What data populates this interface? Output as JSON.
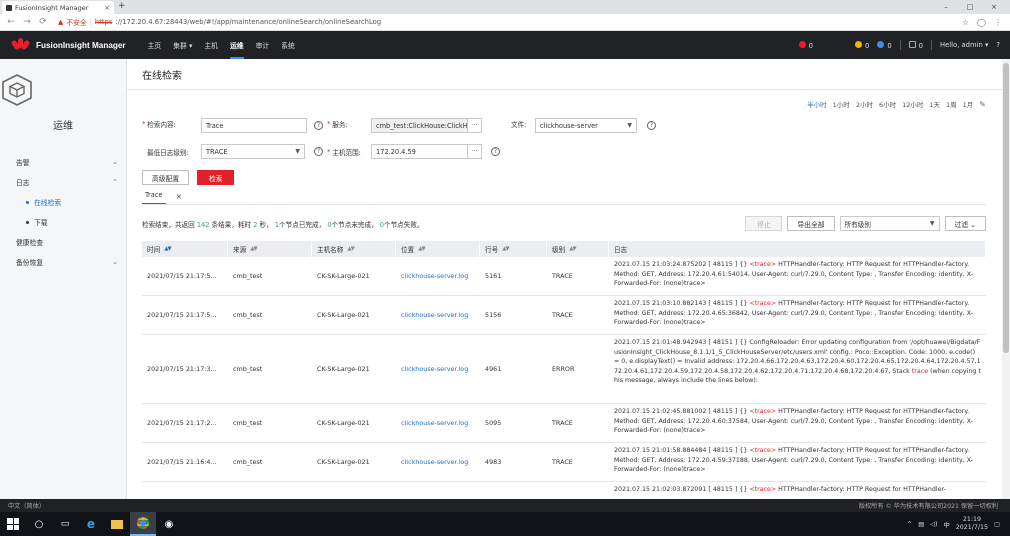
{
  "browser": {
    "tab_title": "FusionInsight Manager",
    "tab_close": "×",
    "new_tab": "+",
    "security_label": "不安全",
    "url_scheme": "https",
    "url_rest": "://172.20.4.67:28443/web/#!/app/maintenance/onlineSearch/onlineSearchLog",
    "window_buttons": [
      "–",
      "□",
      "×"
    ]
  },
  "header": {
    "brand": "FusionInsight Manager",
    "menu": [
      "主页",
      "集群 ▾",
      "主机",
      "运维",
      "审计",
      "系统"
    ],
    "active_menu": "运维",
    "alarm_critical": "0",
    "alarm_major": "0",
    "alarm_minor": "0",
    "alarm_other": "0",
    "user": "Hello, admin ▾",
    "help": "?",
    "colors": {
      "critical": "#e3212b",
      "major": "#f5b300",
      "minor": "#3e8ee9",
      "other": "#888888"
    }
  },
  "sidebar": {
    "title": "运维",
    "items": [
      {
        "label": "告警",
        "chevron": "⌄"
      },
      {
        "label": "日志",
        "chevron": "⌃"
      },
      {
        "label": "在线检索",
        "active": true
      },
      {
        "label": "下载"
      },
      {
        "label": "健康检查"
      },
      {
        "label": "备份恢复",
        "chevron": "⌄"
      }
    ]
  },
  "main": {
    "title": "在线检索",
    "time_range": [
      "半小时",
      "1小时",
      "2小时",
      "6小时",
      "12小时",
      "1天",
      "1周",
      "1月"
    ],
    "time_active": "半小时",
    "form": {
      "search_label": "检索内容:",
      "search_value": "Trace",
      "service_label": "服务:",
      "service_value": "cmb_test:ClickHouse:ClickHouse",
      "file_label": "文件:",
      "file_value": "clickhouse-server",
      "level_label": "最低日志级别:",
      "level_value": "TRACE",
      "host_label": "主机范围:",
      "host_value": "172.20.4.59",
      "advanced_button": "高级配置",
      "search_button": "检索",
      "more": "···",
      "help": "?"
    },
    "result_tab": "Trace",
    "result_tab_close": "×",
    "result": {
      "prefix": "检索结束，共返回",
      "count": "142",
      "mid1": "条结果，耗时",
      "time": "2",
      "mid2": "秒，",
      "done": "1",
      "done_label": "个节点已完成，",
      "pending": "0",
      "pending_label": "个节点未完成，",
      "failed": "0",
      "failed_label": "个节点失败。"
    },
    "toolbar": {
      "stop": "停止",
      "export": "导出全部",
      "level_filter": "所有级别",
      "filter": "过滤 ⌄"
    },
    "table": {
      "columns": [
        "时间",
        "来源",
        "主机名称",
        "位置",
        "行号",
        "级别",
        "日志"
      ],
      "rows": [
        {
          "time": "2021/07/15 21:17:5...",
          "source": "cmb_test",
          "host": "CK-SK-Large-021",
          "location": "clickhouse-server.log",
          "line": "5161",
          "level": "TRACE",
          "log_pre": "2021.07.15 21:03:24.875202 [ 48115 ] {} ",
          "log_hl": "<trace>",
          "log_post": " HTTPHandler-factory: HTTP Request for HTTPHandler-factory. Method: GET, Address: 172.20.4.61:54014, User-Agent: curl/7.29.0, Content Type: , Transfer Encoding: identity, X-Forwarded-For: (none)trace>"
        },
        {
          "time": "2021/07/15 21:17:5...",
          "source": "cmb_test",
          "host": "CK-SK-Large-021",
          "location": "clickhouse-server.log",
          "line": "5156",
          "level": "TRACE",
          "log_pre": "2021.07.15 21:03:10.882143 [ 48115 ] {} ",
          "log_hl": "<trace>",
          "log_post": " HTTPHandler-factory: HTTP Request for HTTPHandler-factory. Method: GET, Address: 172.20.4.65:36842, User-Agent: curl/7.29.0, Content Type: , Transfer Encoding: identity, X-Forwarded-For: (none)trace>"
        },
        {
          "time": "2021/07/15 21:17:3...",
          "source": "cmb_test",
          "host": "CK-SK-Large-021",
          "location": "clickhouse-server.log",
          "line": "4961",
          "level": "ERROR",
          "log_pre": "2021.07.15 21:01:48.942943 [ 48151 ] {} ConfigReloader: Error updating configuration from '/opt/huawei/Bigdata/FusionInsight_ClickHouse_8.1.1/1_5_ClickHouseServer/etc/users.xml' config.: Poco::Exception. Code: 1000, e.code() = 0, e.displayText() = Invalid address: 172.20.4.66,172.20.4.63,172.20.4.60,172.20.4.65,172.20.4.64,172.20.4.57,172.20.4.61,172.20.4.59,172.20.4.58,172.20.4.62,172.20.4.71,172.20.4.68,172.20.4.67, Stack ",
          "log_hl": "trace",
          "log_post": " (when copying this message, always include the lines below):"
        },
        {
          "time": "2021/07/15 21:17:2...",
          "source": "cmb_test",
          "host": "CK-SK-Large-021",
          "location": "clickhouse-server.log",
          "line": "5095",
          "level": "TRACE",
          "log_pre": "2021.07.15 21:02:45.881002 [ 48115 ] {} ",
          "log_hl": "<trace>",
          "log_post": " HTTPHandler-factory: HTTP Request for HTTPHandler-factory. Method: GET, Address: 172.20.4.60:37584, User-Agent: curl/7.29.0, Content Type: , Transfer Encoding: identity, X-Forwarded-For: (none)trace>"
        },
        {
          "time": "2021/07/15 21:16:4...",
          "source": "cmb_test",
          "host": "CK-SK-Large-021",
          "location": "clickhouse-server.log",
          "line": "4983",
          "level": "TRACE",
          "log_pre": "2021.07.15 21:01:58.884484 [ 48115 ] {} ",
          "log_hl": "<trace>",
          "log_post": " HTTPHandler-factory: HTTP Request for HTTPHandler-factory. Method: GET, Address: 172.20.4.59:37188, User-Agent: curl/7.29.0, Content Type: , Transfer Encoding: identity, X-Forwarded-For: (none)trace>"
        },
        {
          "time": "",
          "source": "",
          "host": "",
          "location": "",
          "line": "",
          "level": "",
          "log_pre": "2021.07.15 21:02:03.872091 [ 48115 ] {} ",
          "log_hl": "<trace>",
          "log_post": " HTTPHandler-factory: HTTP Request for HTTPHandler-"
        }
      ]
    }
  },
  "footer": {
    "lang": "中文（简体）",
    "copyright": "版权所有 © 华为技术有限公司2021 保留一切权利"
  },
  "taskbar": {
    "time": "21:19",
    "date": "2021/7/15"
  }
}
